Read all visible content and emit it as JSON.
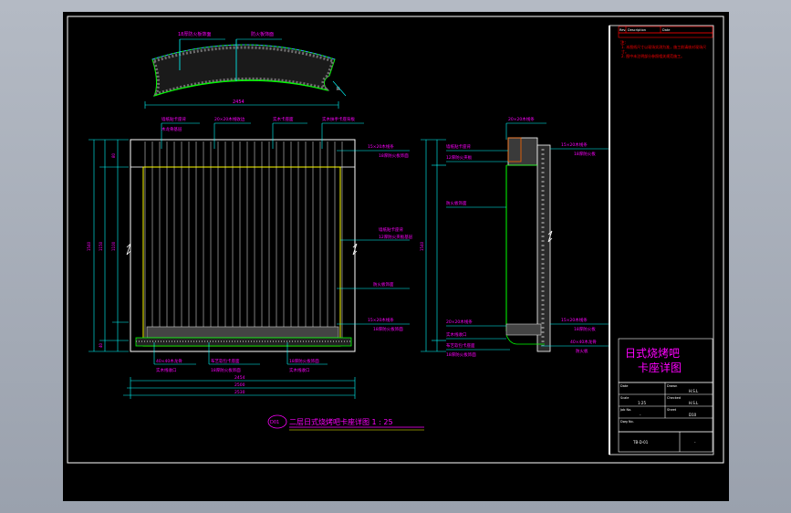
{
  "title_block": {
    "header_cells": [
      "Rev.",
      "Description",
      "Date"
    ],
    "notes_label": "注:",
    "note_1": "1. 本图纸尺寸以现场实测为准，施工前请核对现场尺寸。",
    "note_2": "2. 图中未注明部分参照相关规范施工。",
    "drawing_title_line1": "日式烧烤吧",
    "drawing_title_line2": "卡座详图",
    "info_rows": [
      {
        "left_label": "Date",
        "left_value": "",
        "right_label": "Drawn",
        "right_value": "H.S.L"
      },
      {
        "left_label": "Scale",
        "left_value": "1:25",
        "right_label": "Checked",
        "right_value": "H.S.L"
      },
      {
        "left_label": "Job No.",
        "left_value": "-",
        "right_label": "Sheet",
        "right_value": "D10"
      },
      {
        "left_label": "Dwg No.",
        "left_value": "",
        "right_label": "",
        "right_value": ""
      }
    ],
    "bottom_left": "TB-D-01",
    "bottom_right": "-"
  },
  "main_title": {
    "index": "D01",
    "text": "二层日式烧烤吧卡座详图 1 : 25"
  },
  "arch_labels": {
    "top_left": "18厚防火板饰面",
    "top_right": "防火板饰面",
    "bottom_dim": "2454",
    "side_mark": "R"
  },
  "elevation_labels": {
    "top_1": "墙纸贴卡座背",
    "top_2": "20×20木线收边",
    "top_3": "实木卡座面",
    "top_4": "实木扶手卡座背板",
    "top_5": "木龙骨基层",
    "right_1": "15×20木线条",
    "right_2": "18厚防火板饰面",
    "right_3": "墙纸贴卡座背",
    "right_4": "12厚防火夹板基层",
    "right_5": "防火板饰面",
    "right_6": "15×20木线条",
    "right_7": "18厚防火板饰面",
    "bottom_1": "40×40木龙骨",
    "bottom_2": "布艺软包卡座面",
    "bottom_3": "18厚防火板饰面",
    "bottom_4": "实木线收口",
    "dim_total_1": "2454",
    "dim_total_2": "2500",
    "dim_total_3": "2530",
    "dim_left": "1540",
    "dim_left_inner": "1150",
    "dim_left_top": "80",
    "dim_left_bottom": "40",
    "dim_mid": "1100"
  },
  "section_labels": {
    "top_1": "20×20木线条",
    "left_1": "墙纸贴卡座背",
    "left_2": "12厚防火夹板",
    "left_3": "防火板饰面",
    "right_1": "15×20木线条",
    "right_2": "18厚防火板",
    "bottom_1": "20×20木线条",
    "bottom_2": "实木线收口",
    "bottom_3": "布艺软包卡座面",
    "bottom_4": "18厚防火板饰面",
    "right_bottom_1": "15×20木线条",
    "right_bottom_2": "18厚防火板",
    "right_bottom_3": "40×40木龙骨",
    "right_bottom_4": "防火板",
    "dim_height": "1540"
  },
  "colors": {
    "background": "#000000",
    "cad_bg_outer": "#a5abb6",
    "cyan": "#00ffff",
    "magenta": "#ff00ff",
    "white": "#ffffff",
    "yellow": "#ffff00",
    "green": "#00ff00",
    "red": "#ff0000"
  }
}
